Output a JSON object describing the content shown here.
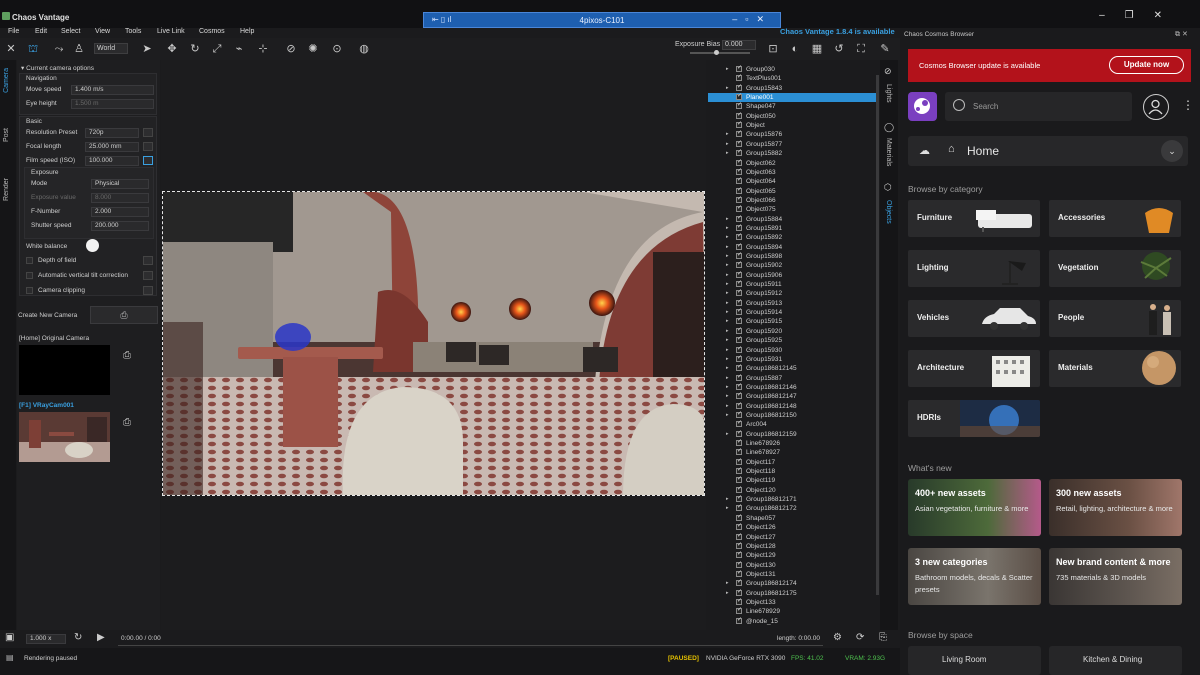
{
  "app": {
    "title": "Chaos Vantage",
    "update_notice": "Chaos Vantage 1.8.4 is available"
  },
  "remote_desktop": {
    "title": "4pixos-C101"
  },
  "menu": [
    "File",
    "Edit",
    "Select",
    "View",
    "Tools",
    "Live Link",
    "Cosmos",
    "Help"
  ],
  "toolbar": {
    "space_select": "World",
    "exposure_bias_label": "Exposure Bias",
    "exposure_bias_value": "0.000"
  },
  "left_tabs": [
    "Camera",
    "Post",
    "Render"
  ],
  "camera_panel": {
    "header": "Current camera options",
    "navigation_label": "Navigation",
    "move_speed_label": "Move speed",
    "move_speed": "1.400 m/s",
    "eye_height_label": "Eye height",
    "eye_height": "1.500 m",
    "basic_label": "Basic",
    "resolution_label": "Resolution Preset",
    "resolution": "720p",
    "focal_label": "Focal length",
    "focal": "25.000 mm",
    "film_label": "Film speed (ISO)",
    "film": "100.000",
    "exposure_label": "Exposure",
    "mode_label": "Mode",
    "mode": "Physical",
    "exposure_value_label": "Exposure value",
    "exposure_value": "8.000",
    "fnumber_label": "F-Number",
    "fnumber": "2.000",
    "shutter_label": "Shutter speed",
    "shutter": "200.000",
    "white_balance_label": "White balance",
    "dof_label": "Depth of field",
    "tilt_label": "Automatic vertical tilt correction",
    "clipping_label": "Camera clipping",
    "create_camera_label": "Create New Camera",
    "cam1_label": "[Home] Original Camera",
    "cam2_label": "[F1] VRayCam001"
  },
  "outliner": {
    "selected": "Plane001",
    "items": [
      {
        "name": "Group030",
        "group": true
      },
      {
        "name": "TextPlus001",
        "group": false
      },
      {
        "name": "Group15843",
        "group": true
      },
      {
        "name": "Plane001",
        "group": false
      },
      {
        "name": "Shape047",
        "group": false
      },
      {
        "name": "Object050",
        "group": false
      },
      {
        "name": "Object",
        "group": false
      },
      {
        "name": "Group15876",
        "group": true
      },
      {
        "name": "Group15877",
        "group": true
      },
      {
        "name": "Group15882",
        "group": true
      },
      {
        "name": "Object062",
        "group": false
      },
      {
        "name": "Object063",
        "group": false
      },
      {
        "name": "Object064",
        "group": false
      },
      {
        "name": "Object065",
        "group": false
      },
      {
        "name": "Object066",
        "group": false
      },
      {
        "name": "Object075",
        "group": false
      },
      {
        "name": "Group15884",
        "group": true
      },
      {
        "name": "Group15891",
        "group": true
      },
      {
        "name": "Group15892",
        "group": true
      },
      {
        "name": "Group15894",
        "group": true
      },
      {
        "name": "Group15898",
        "group": true
      },
      {
        "name": "Group15902",
        "group": true
      },
      {
        "name": "Group15906",
        "group": true
      },
      {
        "name": "Group15911",
        "group": true
      },
      {
        "name": "Group15912",
        "group": true
      },
      {
        "name": "Group15913",
        "group": true
      },
      {
        "name": "Group15914",
        "group": true
      },
      {
        "name": "Group15915",
        "group": true
      },
      {
        "name": "Group15920",
        "group": true
      },
      {
        "name": "Group15925",
        "group": true
      },
      {
        "name": "Group15930",
        "group": true
      },
      {
        "name": "Group15931",
        "group": true
      },
      {
        "name": "Group186812145",
        "group": true
      },
      {
        "name": "Group15887",
        "group": true
      },
      {
        "name": "Group186812146",
        "group": true
      },
      {
        "name": "Group186812147",
        "group": true
      },
      {
        "name": "Group186812148",
        "group": true
      },
      {
        "name": "Group186812150",
        "group": true
      },
      {
        "name": "Arc004",
        "group": false
      },
      {
        "name": "Group186812159",
        "group": true
      },
      {
        "name": "Line678926",
        "group": false
      },
      {
        "name": "Line678927",
        "group": false
      },
      {
        "name": "Object117",
        "group": false
      },
      {
        "name": "Object118",
        "group": false
      },
      {
        "name": "Object119",
        "group": false
      },
      {
        "name": "Object120",
        "group": false
      },
      {
        "name": "Group186812171",
        "group": true
      },
      {
        "name": "Group186812172",
        "group": true
      },
      {
        "name": "Shape057",
        "group": false
      },
      {
        "name": "Object126",
        "group": false
      },
      {
        "name": "Object127",
        "group": false
      },
      {
        "name": "Object128",
        "group": false
      },
      {
        "name": "Object129",
        "group": false
      },
      {
        "name": "Object130",
        "group": false
      },
      {
        "name": "Object131",
        "group": false
      },
      {
        "name": "Group186812174",
        "group": true
      },
      {
        "name": "Group186812175",
        "group": true
      },
      {
        "name": "Object133",
        "group": false
      },
      {
        "name": "Line678929",
        "group": false
      },
      {
        "name": "@node_15",
        "group": false
      }
    ]
  },
  "right_tabs": [
    "Lights",
    "Materials",
    "Objects"
  ],
  "cosmos": {
    "title": "Chaos Cosmos Browser",
    "banner_text": "Cosmos Browser update is available",
    "update_button": "Update now",
    "search_placeholder": "Search",
    "home_label": "Home",
    "browse_category_label": "Browse by category",
    "categories": [
      "Furniture",
      "Accessories",
      "Lighting",
      "Vegetation",
      "Vehicles",
      "People",
      "Architecture",
      "Materials",
      "HDRIs"
    ],
    "whats_new_label": "What's new",
    "news": [
      {
        "title": "400+ new assets",
        "sub": "Asian vegetation, furniture & more"
      },
      {
        "title": "300 new assets",
        "sub": "Retail, lighting, architecture & more"
      },
      {
        "title": "3 new categories",
        "sub": "Bathroom models, decals & Scatter presets"
      },
      {
        "title": "New brand content & more",
        "sub": "735 materials & 3D models"
      }
    ],
    "browse_space_label": "Browse by space",
    "spaces": [
      "Living Room",
      "Kitchen & Dining"
    ]
  },
  "timeline": {
    "speed": "1.000 x",
    "time": "0:00.00 / 0:00",
    "length": "length: 0:00.00"
  },
  "status": {
    "left": "Rendering paused",
    "paused": "[PAUSED]",
    "gpu": "NVIDIA GeForce RTX 3090",
    "fps": "FPS: 41.02",
    "vram": "VRAM: 2.93G"
  },
  "colors": {
    "accent": "#2b8fd4",
    "banner": "#b3121b",
    "paused": "#e6c200",
    "fps": "#4ec24e"
  }
}
